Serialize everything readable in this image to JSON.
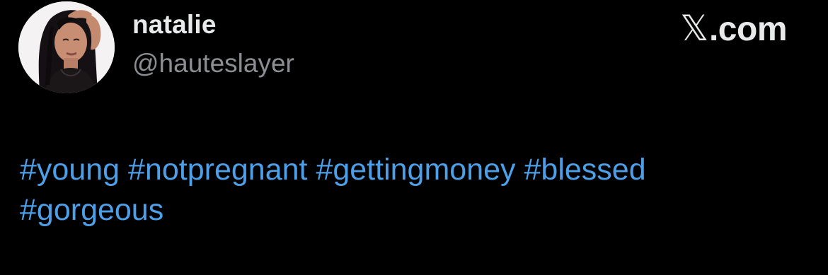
{
  "tweet": {
    "author": {
      "display_name": "natalie",
      "handle": "@hauteslayer"
    },
    "brand": {
      "x_mark": "𝕏",
      "domain": ".com"
    },
    "hashtag_lines": [
      [
        "#young",
        "#notpregnant",
        "#gettingmoney",
        "#blessed"
      ],
      [
        "#gorgeous"
      ]
    ]
  },
  "colors": {
    "background": "#000000",
    "name_text": "#e7e9ea",
    "handle_text": "#8b8f94",
    "link_blue": "#4d9fe8"
  },
  "icons": {
    "avatar": "profile-photo",
    "brand": "x-logo-icon"
  }
}
